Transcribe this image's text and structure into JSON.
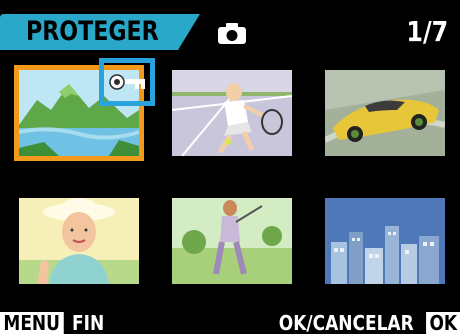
{
  "header": {
    "mode_label": "PROTEGER",
    "mode_icon": "camera-icon",
    "counter": "1/7"
  },
  "thumbnails": [
    {
      "subject": "mountain-lake-landscape",
      "selected": true,
      "protected": true
    },
    {
      "subject": "tennis-player"
    },
    {
      "subject": "sports-car"
    },
    {
      "subject": "woman-with-hat"
    },
    {
      "subject": "golfer"
    },
    {
      "subject": "city-skyline"
    }
  ],
  "footer": {
    "menu_key": "MENU",
    "menu_action": "FIN",
    "ok_action": "OK/CANCELAR",
    "ok_key": "OK"
  },
  "colors": {
    "tab": "#2aa8c9",
    "selection": "#f39a1c",
    "protect_highlight": "#2aa2db"
  }
}
